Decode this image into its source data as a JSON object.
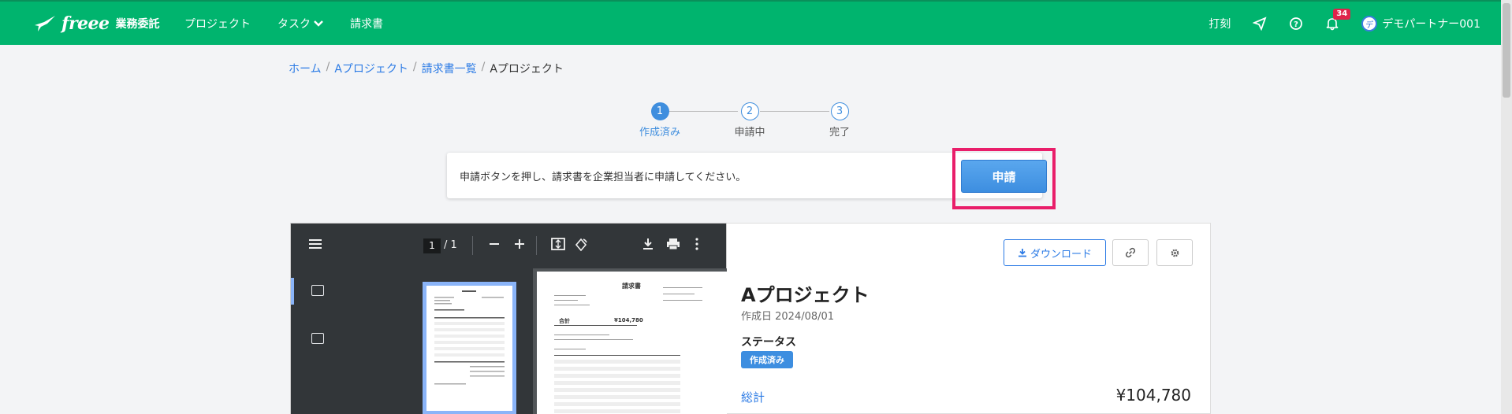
{
  "header": {
    "logo_text": "freee",
    "logo_sub": "業務委託",
    "nav": [
      {
        "label": "プロジェクト"
      },
      {
        "label": "タスク"
      },
      {
        "label": "請求書"
      }
    ],
    "clock_label": "打刻",
    "notification_count": "34",
    "avatar_letter": "デ",
    "user_name": "デモパートナー001"
  },
  "breadcrumb": {
    "items": [
      "ホーム",
      "Aプロジェクト",
      "請求書一覧"
    ],
    "current": "Aプロジェクト",
    "separator": "/"
  },
  "steps": [
    {
      "number": "1",
      "label": "作成済み"
    },
    {
      "number": "2",
      "label": "申請中"
    },
    {
      "number": "3",
      "label": "完了"
    }
  ],
  "notice": {
    "text": "申請ボタンを押し、請求書を企業担当者に申請してください。",
    "apply_label": "申請"
  },
  "pdf_viewer": {
    "page_current": "1",
    "page_total": "/ 1",
    "doc_title": "請求書",
    "doc_total_label": "合計",
    "doc_total_value": "¥104,780"
  },
  "info": {
    "download_label": "ダウンロード",
    "title": "Aプロジェクト",
    "created": "作成日 2024/08/01",
    "status_label": "ステータス",
    "status_value": "作成済み",
    "total_label": "総計",
    "total_value": "¥104,780"
  },
  "colors": {
    "brand_green": "#00b46e",
    "accent_blue": "#3d8ee0",
    "highlight": "#e91e6a"
  }
}
